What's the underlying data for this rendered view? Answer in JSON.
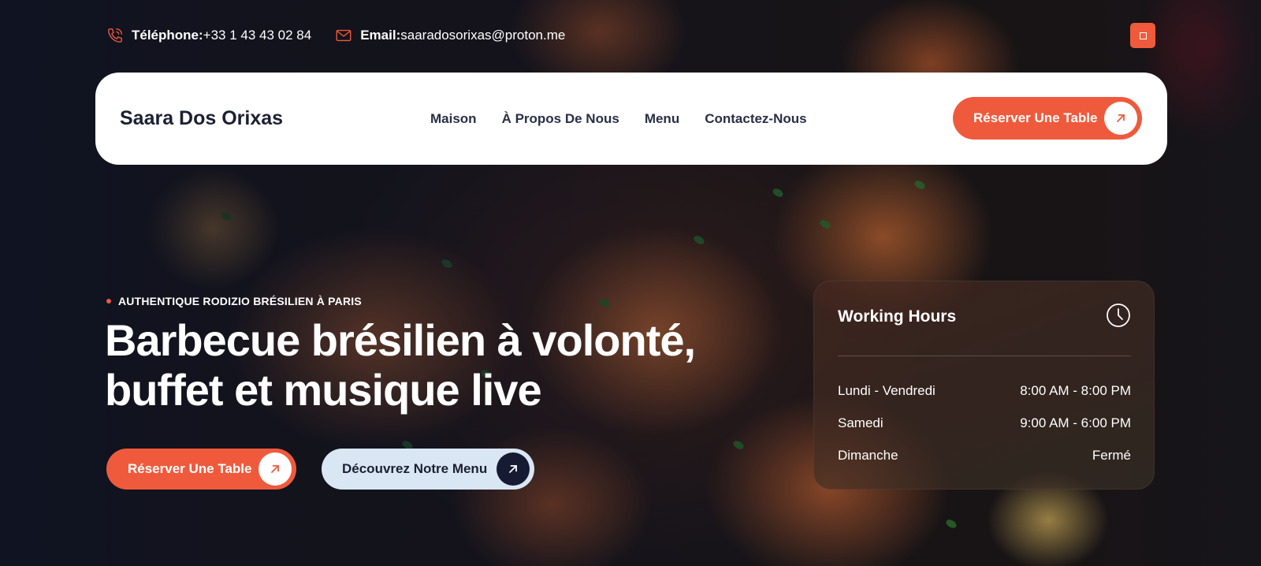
{
  "topbar": {
    "phone_label": "Téléphone:",
    "phone_value": "+33 1 43 43 02 84",
    "email_label": "Email:",
    "email_value": "saaradosorixas@proton.me",
    "phone_icon": "phone-icon",
    "email_icon": "envelope-icon"
  },
  "nav": {
    "brand": "Saara Dos Orixas",
    "items": [
      {
        "label": "Maison"
      },
      {
        "label": "À Propos De Nous"
      },
      {
        "label": "Menu"
      },
      {
        "label": "Contactez-Nous"
      }
    ],
    "cta_label": "Réserver Une Table"
  },
  "hero": {
    "eyebrow": "AUTHENTIQUE RODIZIO BRÉSILIEN À PARIS",
    "headline_line1": "Barbecue brésilien à volonté,",
    "headline_line2": "buffet et musique live",
    "primary_button": "Réserver Une Table",
    "secondary_button": "Découvrez Notre Menu"
  },
  "hours": {
    "title": "Working Hours",
    "rows": [
      {
        "day": "Lundi - Vendredi",
        "time": "8:00 AM - 8:00 PM"
      },
      {
        "day": "Samedi",
        "time": "9:00 AM - 6:00 PM"
      },
      {
        "day": "Dimanche",
        "time": "Fermé"
      }
    ]
  },
  "colors": {
    "accent": "#ef5a3c",
    "navy": "#161a33",
    "light_button": "#d9e6f3"
  }
}
